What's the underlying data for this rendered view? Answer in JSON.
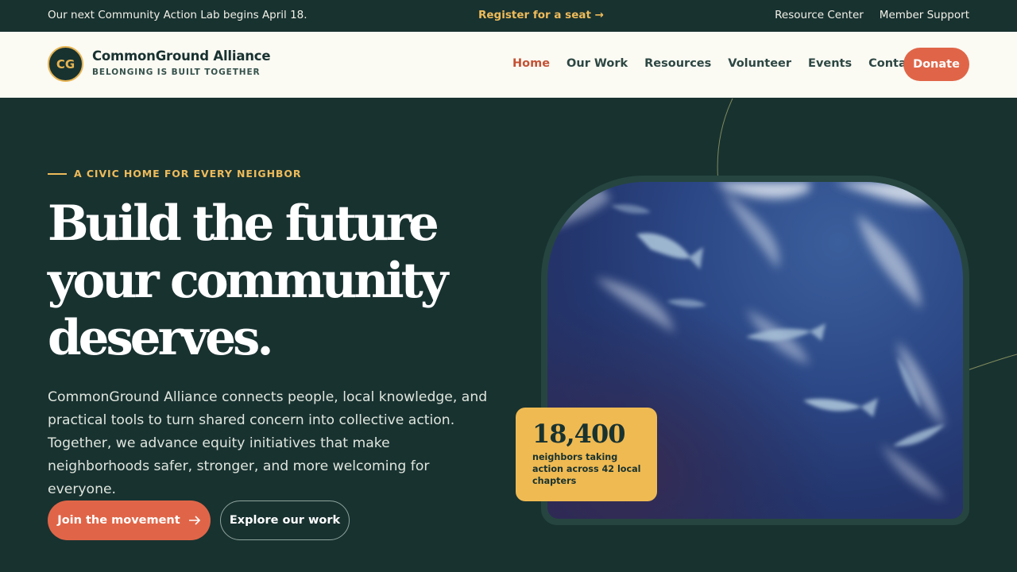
{
  "topbar": {
    "announcement": "Our next Community Action Lab begins April 18.",
    "register_link": "Register for a seat →",
    "links": [
      "Resource Center",
      "Member Support"
    ]
  },
  "nav": {
    "logo_initials": "CG",
    "brand_name": "CommonGround Alliance",
    "brand_tagline": "BELONGING IS BUILT TOGETHER",
    "menu": [
      {
        "label": "Home",
        "active": true
      },
      {
        "label": "Our Work",
        "active": false
      },
      {
        "label": "Resources",
        "active": false
      },
      {
        "label": "Volunteer",
        "active": false
      },
      {
        "label": "Events",
        "active": false
      },
      {
        "label": "Contact",
        "active": false
      }
    ],
    "donate_label": "Donate"
  },
  "hero": {
    "eyebrow": "A CIVIC HOME FOR EVERY NEIGHBOR",
    "headline_lines": [
      "Build the future",
      "your community",
      "deserves."
    ],
    "lede": "CommonGround Alliance connects people, local knowledge, and practical tools to turn shared concern into collective action. Together, we advance equity initiatives that make neighborhoods safer, stronger, and more welcoming for everyone.",
    "primary_cta": "Join the movement",
    "primary_cta_icon": "arrow-right-icon",
    "secondary_cta": "Explore our work"
  },
  "stat": {
    "number": "18,400",
    "label": "neighbors taking action across 42 local chapters"
  },
  "colors": {
    "background": "#183230",
    "accent": "#e06548",
    "gold": "#eebb5a",
    "nav_bg": "#fbfaf3"
  }
}
